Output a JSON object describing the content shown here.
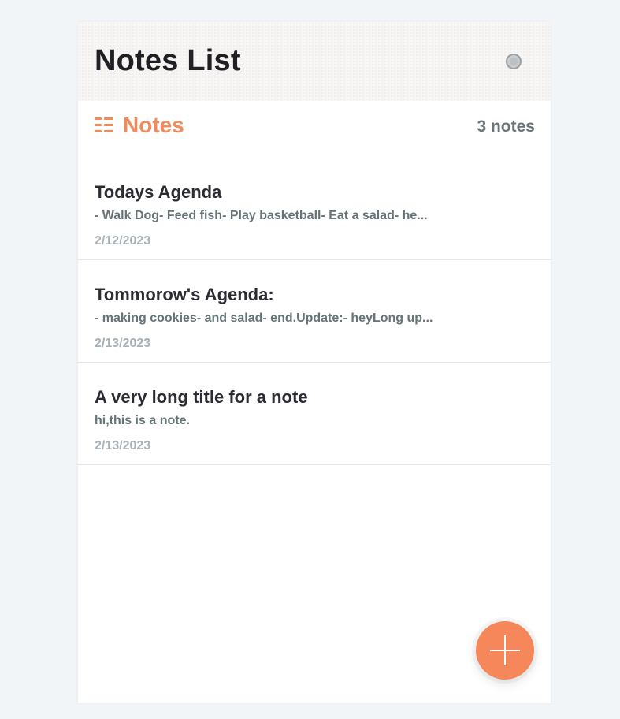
{
  "app": {
    "title": "Notes List",
    "theme_toggle_icon": "circle-toggle-icon"
  },
  "section": {
    "icon": "list-icon",
    "label": "Notes",
    "count_text": "3 notes"
  },
  "notes": [
    {
      "title": "Todays Agenda",
      "preview": "- Walk Dog- Feed fish- Play basketball- Eat a salad- he...",
      "date": "2/12/2023"
    },
    {
      "title": "Tommorow's Agenda:",
      "preview": "- making cookies- and salad- end.Update:- heyLong up...",
      "date": "2/13/2023"
    },
    {
      "title": "A very long title for a note",
      "preview": "hi,this is a note.",
      "date": "2/13/2023"
    }
  ],
  "fab": {
    "icon": "plus-icon"
  },
  "colors": {
    "accent": "#f28a5c",
    "fab": "#f5875a",
    "page_background": "#f2f5f8",
    "title_text": "#1f1f24",
    "muted_text": "#697479",
    "date_text": "#a7b0b6"
  }
}
